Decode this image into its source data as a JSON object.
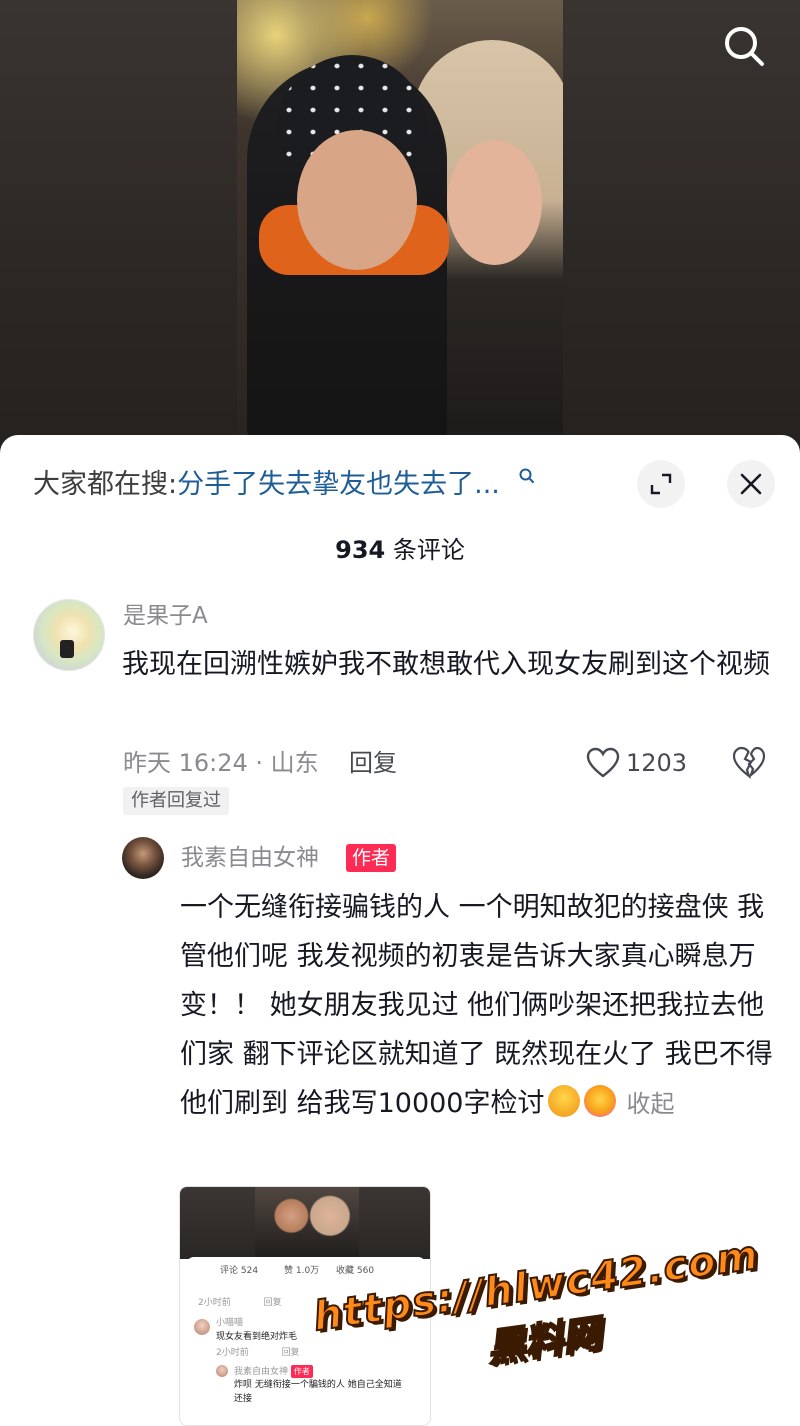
{
  "video": {
    "search_icon": "search-icon"
  },
  "sheet": {
    "search_prefix": "大家都在搜:",
    "search_query": "分手了失去挚友也失去了...",
    "comment_count_num": "934",
    "comment_count_suffix": " 条评论",
    "expand_icon": "expand-icon",
    "close_icon": "close-icon"
  },
  "comments": [
    {
      "username": "是果子A",
      "text": "我现在回溯性嫉妒我不敢想敢代入现女友刷到这个视频",
      "meta": "昨天 16:24 · 山东",
      "reply_label": "回复",
      "likes": "1203",
      "author_replied": "作者回复过"
    }
  ],
  "reply": {
    "username": "我素自由女神",
    "badge": "作者",
    "text": "一个无缝衔接骗钱的人 一个明知故犯的接盘侠 我管他们呢 我发视频的初衷是告诉大家真心瞬息万变！！ 她女朋友我见过 他们俩吵架还把我拉去他们家 翻下评论区就知道了 既然现在火了 我巴不得他们刷到 给我写10000字检讨",
    "collapse_label": "收起"
  },
  "thumbnail": {
    "tab_comments": "评论 524",
    "tab_likes": "赞 1.0万",
    "tab_favs": "收藏 560",
    "row1_meta": "2小时前",
    "row1_reply": "回复",
    "user2": "小喵喵",
    "text2": "现女友看到绝对炸毛",
    "row2_meta": "2小时前",
    "row2_reply": "回复",
    "user3": "我素自由女神",
    "badge3": "作者",
    "text3a": "炸呗 无缝衔接一个騙钱的人 她自己全知道",
    "text3b": "还接"
  },
  "watermark": {
    "url": "https://hlwc42.com",
    "name": "黑料网"
  },
  "colors": {
    "accent_red": "#fe2c55",
    "query_blue": "#1f5d96",
    "muted_gray": "#8a8b91",
    "watermark_orange": "#ff8a1a"
  }
}
